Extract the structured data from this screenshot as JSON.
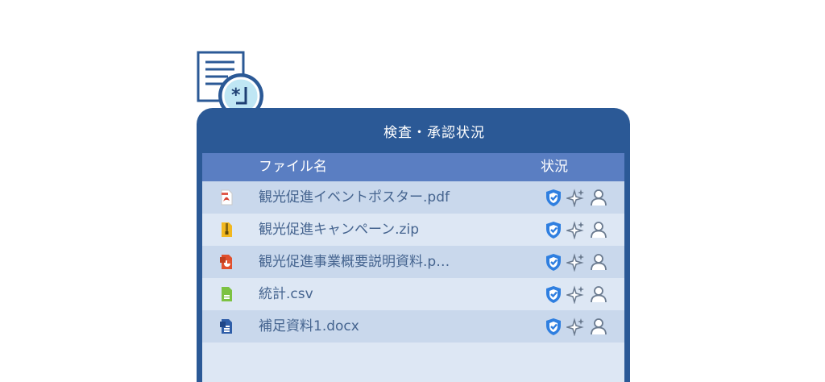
{
  "panel": {
    "title": "検査・承認状況"
  },
  "table": {
    "columns": {
      "name": "ファイル名",
      "status": "状況"
    },
    "rows": [
      {
        "icon": "pdf-file-icon",
        "name": "観光促進イベントポスター.pdf"
      },
      {
        "icon": "zip-file-icon",
        "name": "観光促進キャンペーン.zip"
      },
      {
        "icon": "powerpoint-file-icon",
        "name": "観光促進事業概要説明資料.p…"
      },
      {
        "icon": "csv-file-icon",
        "name": "統計.csv"
      },
      {
        "icon": "word-file-icon",
        "name": "補足資料1.docx"
      }
    ],
    "status_icons": [
      "shield-check-icon",
      "sparkle-icon",
      "user-icon"
    ]
  },
  "colors": {
    "header_bar": "#2b5996",
    "column_header": "#5a7ec2",
    "row_light": "#dde7f4",
    "row_dark": "#c9d8ec",
    "text": "#45648f"
  }
}
